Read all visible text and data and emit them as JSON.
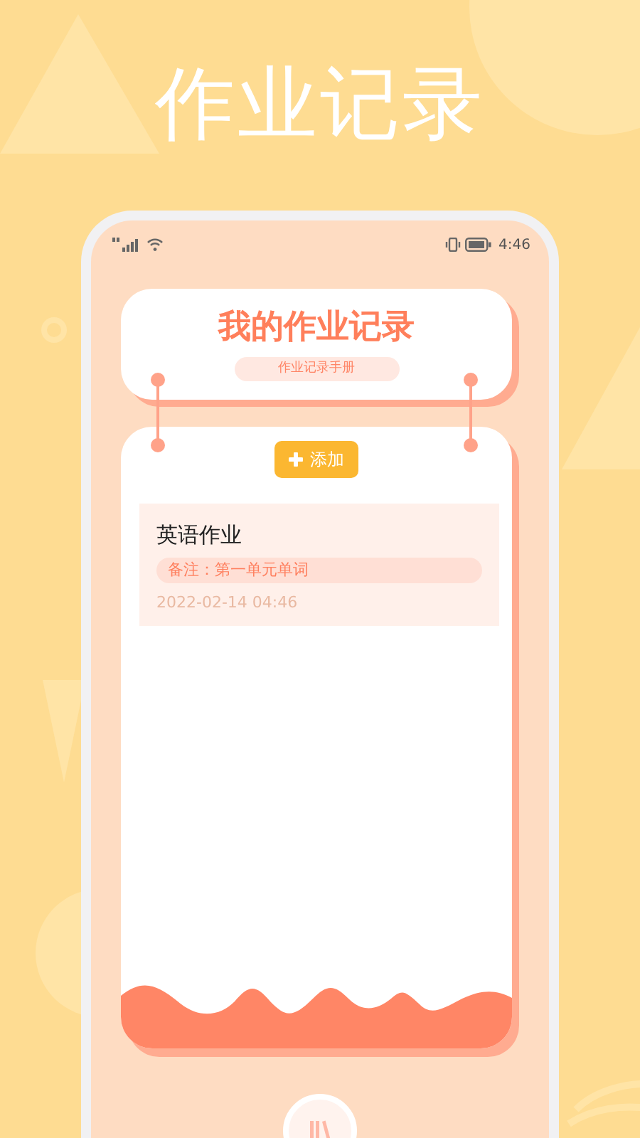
{
  "promo_title": "作业记录",
  "status_bar": {
    "time": "4:46"
  },
  "header": {
    "title": "我的作业记录",
    "subtitle": "作业记录手册"
  },
  "add_button": {
    "label": "添加"
  },
  "records": [
    {
      "title": "英语作业",
      "note": "备注：第一单元单词",
      "date": "2022-02-14 04:46"
    }
  ]
}
